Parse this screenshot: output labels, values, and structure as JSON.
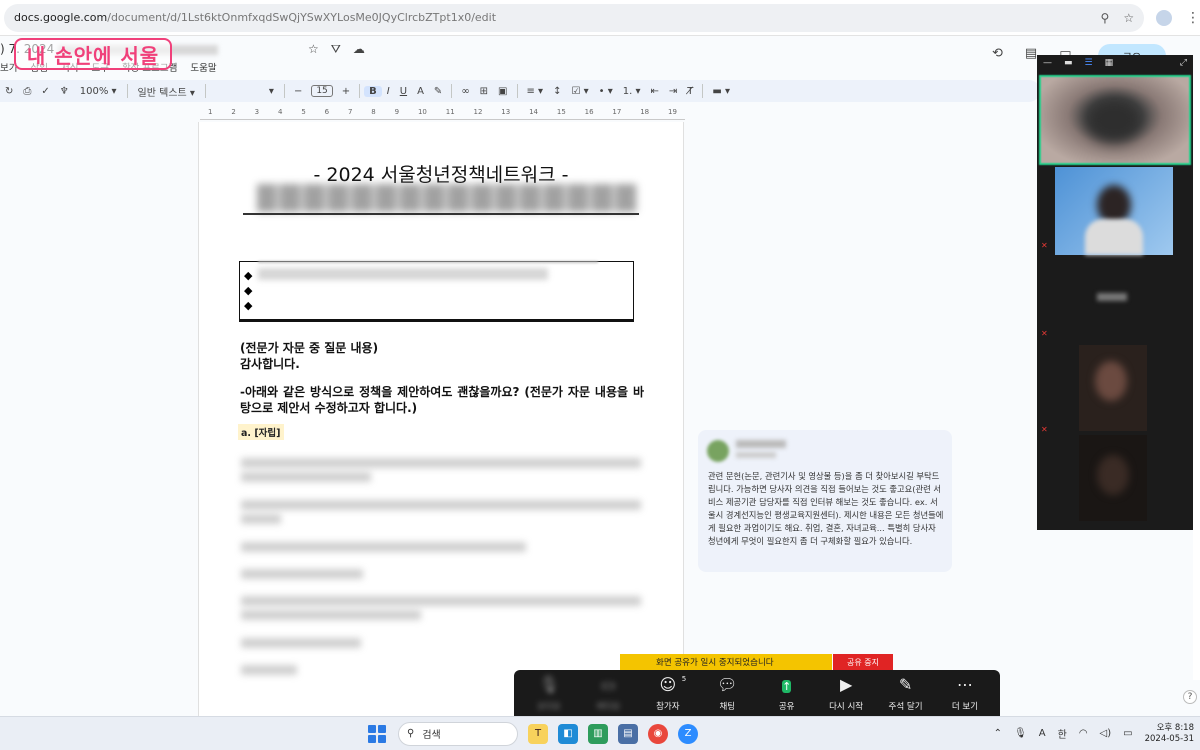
{
  "browser": {
    "url_domain": "docs.google.com",
    "url_path": "/document/d/1Lst6ktOnmfxqdSwQjYSwXYLosMe0JQyClrcbZTpt1x0/edit"
  },
  "docs": {
    "title_prefix": ") 7. 2024",
    "menu": [
      "보기",
      "삽입",
      "서식",
      "도구",
      "확장 프로그램",
      "도움말"
    ],
    "share_label": "공유",
    "stamp_text": "내 손안에 서울"
  },
  "toolbar": {
    "zoom": "100%",
    "style": "일반 텍스트",
    "font_size": "15"
  },
  "ruler": [
    "1",
    "2",
    "3",
    "4",
    "5",
    "6",
    "7",
    "8",
    "9",
    "10",
    "11",
    "12",
    "13",
    "14",
    "15",
    "16",
    "17",
    "18",
    "19"
  ],
  "page": {
    "title": "- 2024 서울청년정책네트워크 -",
    "bullets": [
      "◆",
      "◆",
      "◆"
    ],
    "heading": "(전문가 자문 중 질문 내용)",
    "thanks": "감사합니다.",
    "question": "-아래와 같은 방식으로 정책을 제안하여도 괜찮을까요? (전문가 자문 내용을 바탕으로 제안서 수정하고자 합니다.)",
    "item_label": "a. [자립]"
  },
  "comment": {
    "text": "관련 문헌(논문, 관련기사 및 영상물 등)을 좀 더 찾아보시길 부탁드립니다. 가능하면 당사자 의견을 직접 들어보는 것도 좋고요(관련 서비스 제공기관 담당자를 직접 인터뷰 해보는 것도 좋습니다. ex. 서울시 경계선지능인 평생교육지원센터). 제시한 내용은 모든 청년들에게 필요한 과업이기도 해요. 취업, 결혼, 자녀교육... 특별히 당사자 청년에게 무엇이 필요한지 좀 더 구체화할 필요가 있습니다."
  },
  "zoom": {
    "share_notice": "화면 공유가 일시 중지되었습니다",
    "stop_share": "공유 중지",
    "controls": [
      {
        "label": "오디오",
        "icon": "mic-icon"
      },
      {
        "label": "비디오",
        "icon": "video-icon"
      },
      {
        "label": "참가자",
        "icon": "participants-icon",
        "count": "5"
      },
      {
        "label": "채팅",
        "icon": "chat-icon"
      },
      {
        "label": "공유",
        "icon": "share-icon"
      },
      {
        "label": "다시 시작",
        "icon": "play-icon"
      },
      {
        "label": "주석 달기",
        "icon": "pen-icon"
      },
      {
        "label": "더 보기",
        "icon": "more-icon"
      }
    ]
  },
  "taskbar": {
    "search_placeholder": "검색",
    "ime": "한",
    "ime_a": "A",
    "time": "오후 8:18",
    "date": "2024-05-31"
  },
  "colors": {
    "accent": "#0b57d0",
    "stamp": "#f0407a",
    "zoom_green": "#23d18b",
    "notice_yellow": "#f4c400",
    "stop_red": "#e02424"
  }
}
